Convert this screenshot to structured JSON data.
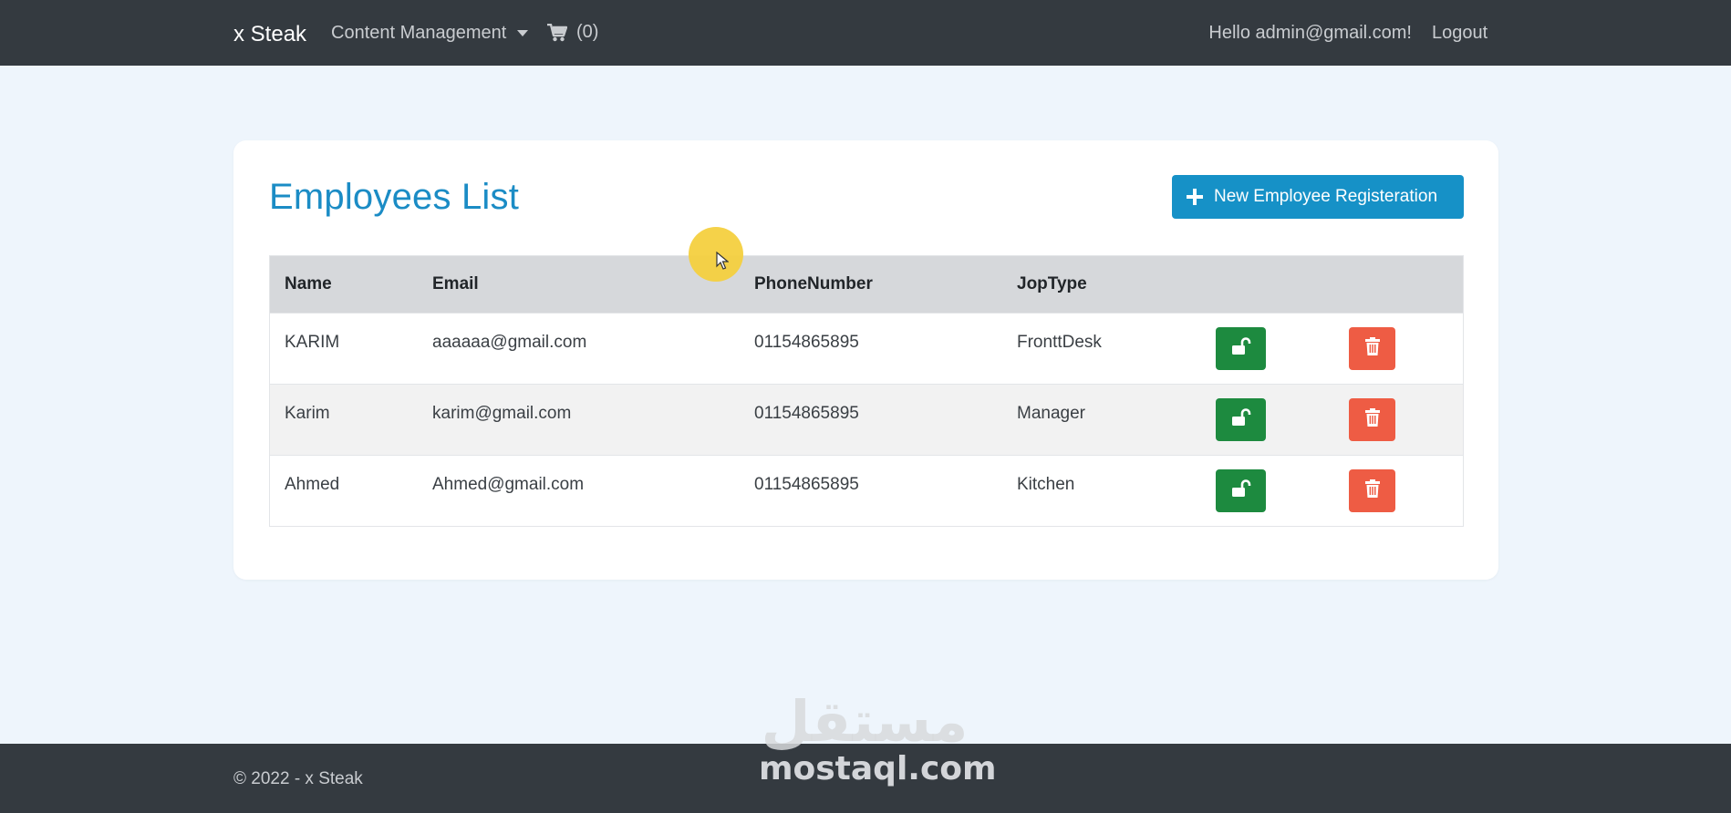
{
  "navbar": {
    "brand": "x Steak",
    "content_management": "Content Management",
    "cart_count": "(0)",
    "greeting": "Hello admin@gmail.com!",
    "logout": "Logout"
  },
  "main": {
    "title": "Employees List",
    "new_button_label": "New Employee Registeration",
    "table": {
      "headers": [
        "Name",
        "Email",
        "PhoneNumber",
        "JopType"
      ],
      "rows": [
        {
          "name": "KARIM",
          "email": "aaaaaa@gmail.com",
          "phone": "01154865895",
          "job": "FronttDesk"
        },
        {
          "name": "Karim",
          "email": "karim@gmail.com",
          "phone": "01154865895",
          "job": "Manager"
        },
        {
          "name": "Ahmed",
          "email": "Ahmed@gmail.com",
          "phone": "01154865895",
          "job": "Kitchen"
        }
      ]
    }
  },
  "footer": {
    "copyright": "© 2022 - x Steak"
  },
  "watermark": {
    "arabic": "مستقل",
    "latin": "mostaql.com"
  },
  "colors": {
    "navbar": "#343a40",
    "accent": "#1691c7",
    "title": "#1b8cc5",
    "lock_button": "#1d8a3f",
    "delete_button": "#ee5c44"
  },
  "icons": {
    "cart": "shopping-cart-icon",
    "plus": "plus-icon",
    "lock": "unlock-icon",
    "delete": "trash-icon"
  }
}
